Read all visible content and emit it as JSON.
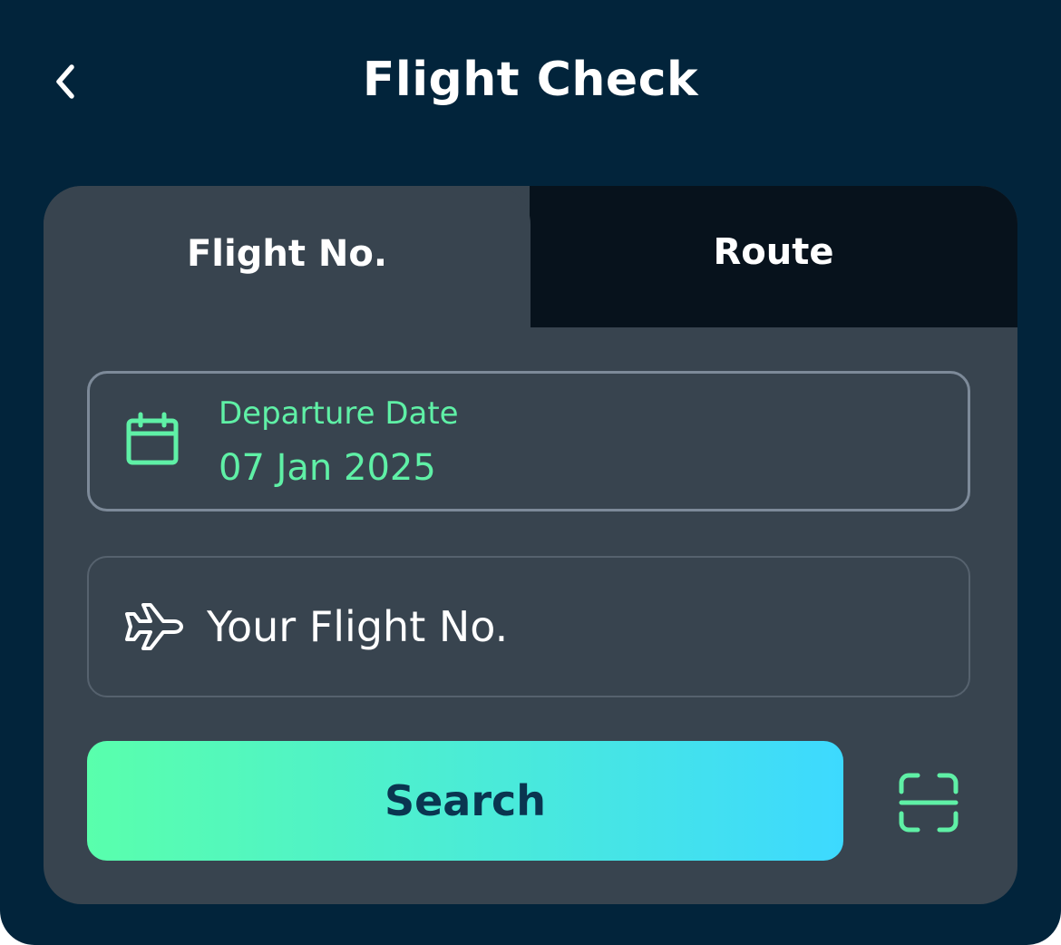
{
  "header": {
    "back_icon": "chevron-left-icon",
    "title": "Flight Check"
  },
  "tabs": [
    {
      "label": "Flight No.",
      "active": true
    },
    {
      "label": "Route",
      "active": false
    }
  ],
  "departure": {
    "icon": "calendar-icon",
    "label": "Departure Date",
    "value": "07 Jan 2025"
  },
  "flight_number": {
    "icon": "airplane-icon",
    "value": "",
    "placeholder": "Your Flight No."
  },
  "actions": {
    "search_label": "Search",
    "scan_icon": "scan-icon"
  },
  "colors": {
    "background": "#02243b",
    "card": "#38444f",
    "inactive_tab": "#07121c",
    "accent": "#5ff0a6",
    "gradient_start": "#59ffac",
    "gradient_end": "#3dd9ff",
    "button_text": "#0a3550"
  }
}
